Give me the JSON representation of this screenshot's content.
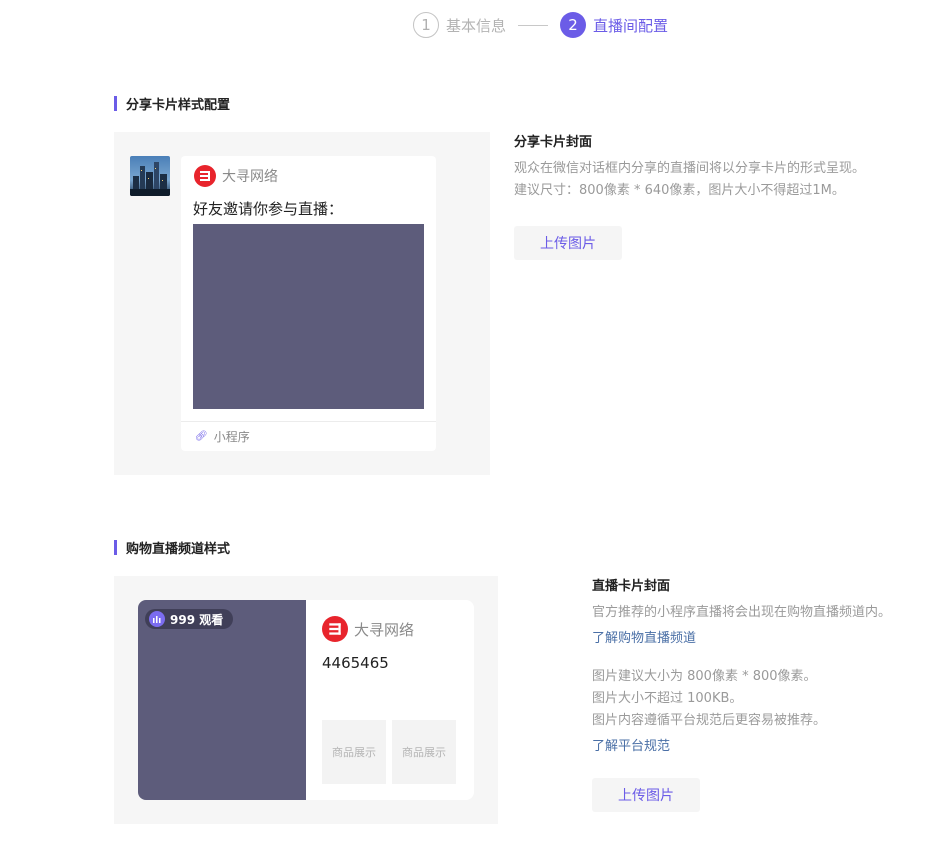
{
  "steps": [
    {
      "number": "1",
      "label": "基本信息",
      "state": "inactive"
    },
    {
      "number": "2",
      "label": "直播间配置",
      "state": "active"
    }
  ],
  "accent_color": "#6b5ce7",
  "section1": {
    "title": "分享卡片样式配置",
    "preview": {
      "brand_name": "大寻网络",
      "invite_text": "好友邀请你参与直播：",
      "mini_program_label": "小程序",
      "mini_program_icon": "link-icon"
    },
    "info": {
      "title": "分享卡片封面",
      "desc_lines": [
        "观众在微信对话框内分享的直播间将以分享卡片的形式呈现。",
        "建议尺寸：800像素 * 640像素，图片大小不得超过1M。"
      ],
      "upload_label": "上传图片"
    }
  },
  "section2": {
    "title": "购物直播频道样式",
    "preview": {
      "view_count": "999 观看",
      "brand_name": "大寻网络",
      "live_title": "4465465",
      "products": [
        "商品展示",
        "商品展示"
      ]
    },
    "info": {
      "title": "直播卡片封面",
      "desc1": "官方推荐的小程序直播将会出现在购物直播频道内。",
      "link1": "了解购物直播频道",
      "desc2_lines": [
        "图片建议大小为 800像素 * 800像素。",
        "图片大小不超过 100KB。",
        "图片内容遵循平台规范后更容易被推荐。"
      ],
      "link2": "了解平台规范",
      "upload_label": "上传图片"
    }
  }
}
